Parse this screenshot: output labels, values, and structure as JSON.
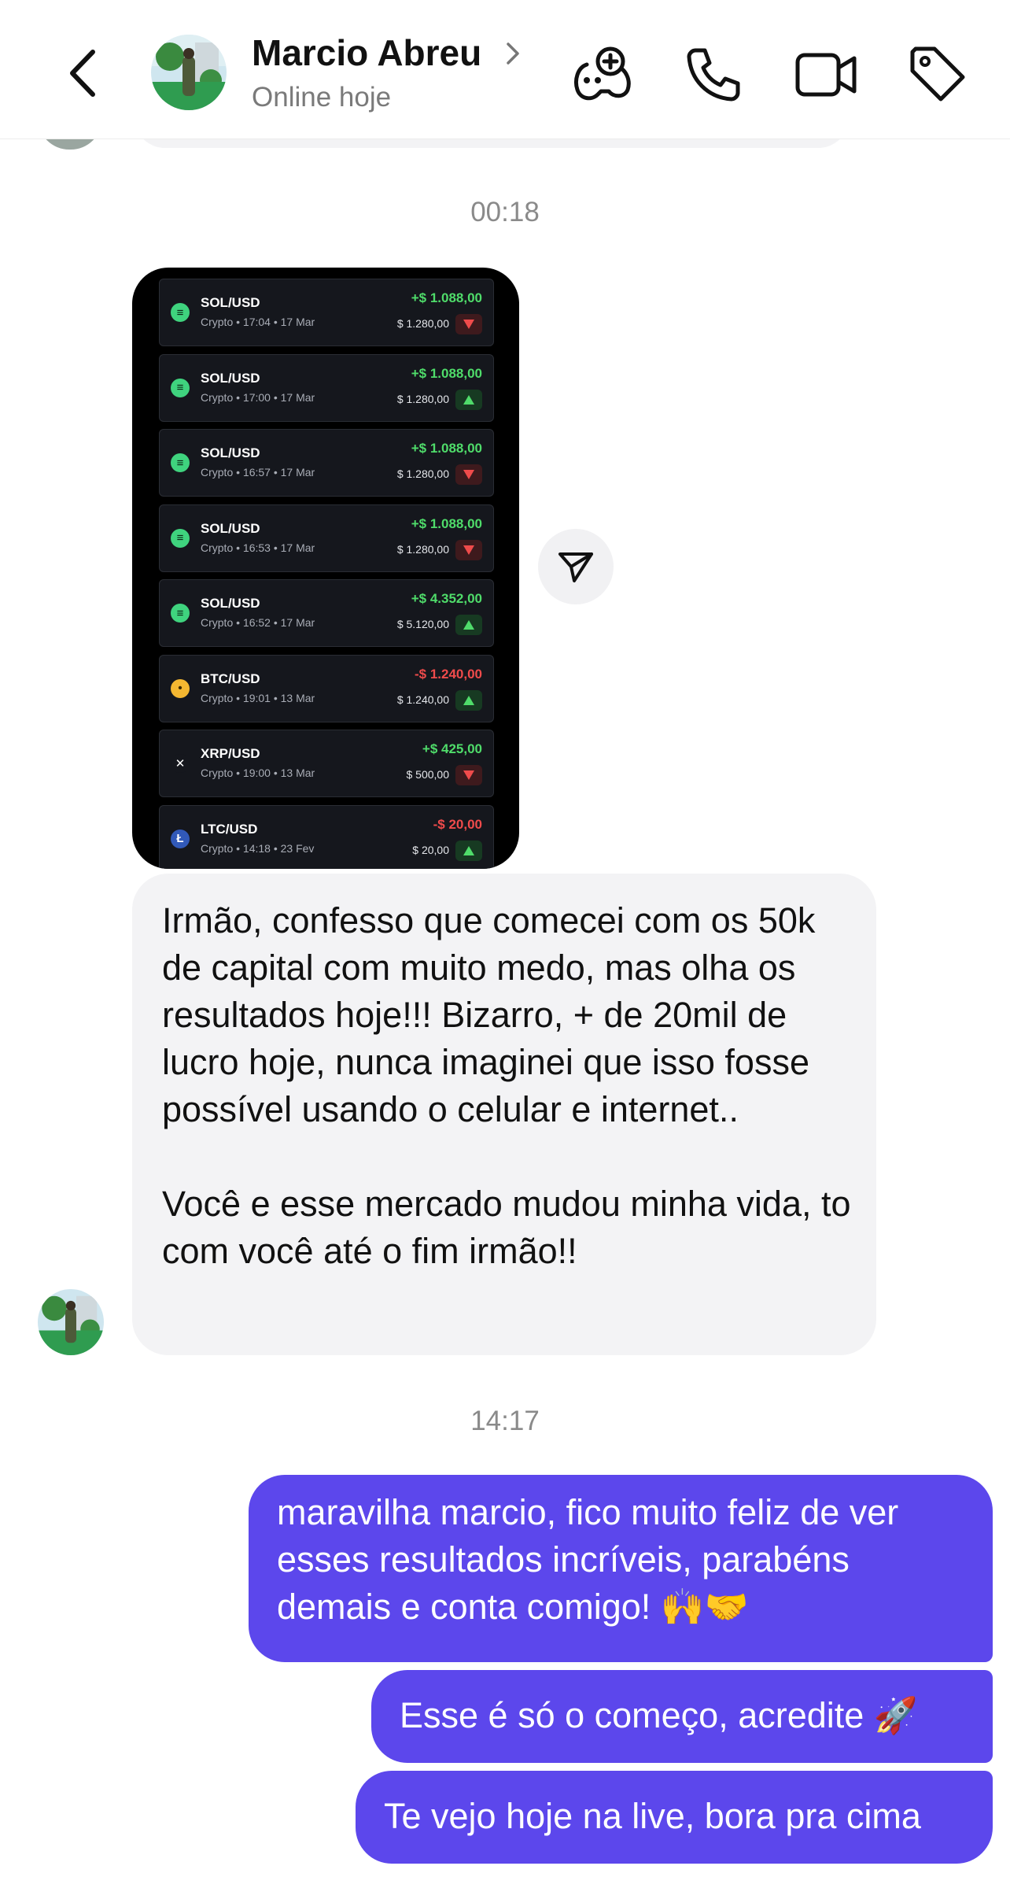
{
  "header": {
    "contact_name": "Marcio Abreu",
    "status": "Online hoje"
  },
  "chat": {
    "timestamp_1": "00:18",
    "trades": [
      {
        "pair": "SOL/USD",
        "meta": "Crypto • 17:04 • 17 Mar",
        "pnl": "+$ 1.088,00",
        "stake": "$ 1.280,00",
        "direction": "down",
        "pnl_color": "#4fdc6a",
        "coin": "SOL"
      },
      {
        "pair": "SOL/USD",
        "meta": "Crypto • 17:00 • 17 Mar",
        "pnl": "+$ 1.088,00",
        "stake": "$ 1.280,00",
        "direction": "up",
        "pnl_color": "#4fdc6a",
        "coin": "SOL"
      },
      {
        "pair": "SOL/USD",
        "meta": "Crypto • 16:57 • 17 Mar",
        "pnl": "+$ 1.088,00",
        "stake": "$ 1.280,00",
        "direction": "down",
        "pnl_color": "#4fdc6a",
        "coin": "SOL"
      },
      {
        "pair": "SOL/USD",
        "meta": "Crypto • 16:53 • 17 Mar",
        "pnl": "+$ 1.088,00",
        "stake": "$ 1.280,00",
        "direction": "down",
        "pnl_color": "#4fdc6a",
        "coin": "SOL"
      },
      {
        "pair": "SOL/USD",
        "meta": "Crypto • 16:52 • 17 Mar",
        "pnl": "+$ 4.352,00",
        "stake": "$ 5.120,00",
        "direction": "up",
        "pnl_color": "#4fdc6a",
        "coin": "SOL"
      },
      {
        "pair": "BTC/USD",
        "meta": "Crypto • 19:01 • 13 Mar",
        "pnl": "-$ 1.240,00",
        "stake": "$ 1.240,00",
        "direction": "up",
        "pnl_color": "#ef4b4b",
        "coin": "BTC"
      },
      {
        "pair": "XRP/USD",
        "meta": "Crypto • 19:00 • 13 Mar",
        "pnl": "+$ 425,00",
        "stake": "$ 500,00",
        "direction": "down",
        "pnl_color": "#4fdc6a",
        "coin": "XRP"
      },
      {
        "pair": "LTC/USD",
        "meta": "Crypto • 14:18 • 23 Fev",
        "pnl": "-$ 20,00",
        "stake": "$ 20,00",
        "direction": "up",
        "pnl_color": "#ef4b4b",
        "coin": "LTC"
      }
    ],
    "incoming_paragraph_1": "Irmão, confesso que comecei com os 50k de capital com muito medo, mas olha os resultados hoje!!! Bizarro, + de 20mil de lucro hoje, nunca imaginei que isso fosse possível usando o celular e internet..",
    "incoming_paragraph_2": "Você e esse mercado mudou minha vida, to com você até o fim irmão!!",
    "timestamp_2": "14:17",
    "outgoing_1": "maravilha marcio, fico muito feliz de ver esses resultados incríveis, parabéns demais e conta comigo! 🙌🤝",
    "outgoing_2": "Esse é só o começo, acredite 🚀",
    "outgoing_3": "Te vejo hoje na live, bora pra cima"
  },
  "colors": {
    "outgoing_bubble": "#5c47ec",
    "incoming_bubble": "#f3f3f5",
    "profit": "#4fdc6a",
    "loss": "#ef4b4b"
  },
  "icons": [
    "back-chevron-icon",
    "chevron-right-icon",
    "game-controller-add-icon",
    "phone-icon",
    "video-camera-icon",
    "tag-icon",
    "share-send-icon"
  ]
}
